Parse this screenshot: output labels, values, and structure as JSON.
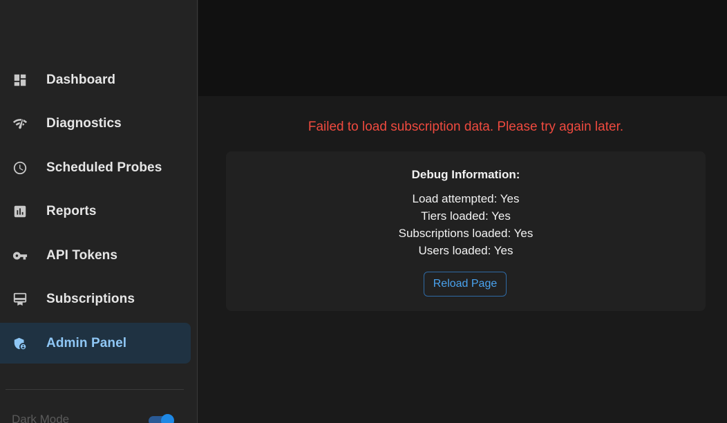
{
  "sidebar": {
    "items": [
      {
        "label": "Dashboard",
        "icon": "dashboard-icon"
      },
      {
        "label": "Diagnostics",
        "icon": "network-check-icon"
      },
      {
        "label": "Scheduled Probes",
        "icon": "clock-icon"
      },
      {
        "label": "Reports",
        "icon": "bar-chart-icon"
      },
      {
        "label": "API Tokens",
        "icon": "key-icon"
      },
      {
        "label": "Subscriptions",
        "icon": "card-membership-icon"
      },
      {
        "label": "Admin Panel",
        "icon": "admin-shield-icon",
        "active": true
      }
    ],
    "dark_mode_label": "Dark Mode",
    "dark_mode_on": true
  },
  "main": {
    "error_message": "Failed to load subscription data. Please try again later.",
    "debug": {
      "title": "Debug Information:",
      "lines": [
        "Load attempted: Yes",
        "Tiers loaded: Yes",
        "Subscriptions loaded: Yes",
        "Users loaded: Yes"
      ],
      "reload_label": "Reload Page"
    }
  },
  "colors": {
    "error": "#ef4a3f",
    "accent": "#4aa3ef",
    "active_bg": "#1f3242",
    "active_text": "#8fc7f5"
  }
}
